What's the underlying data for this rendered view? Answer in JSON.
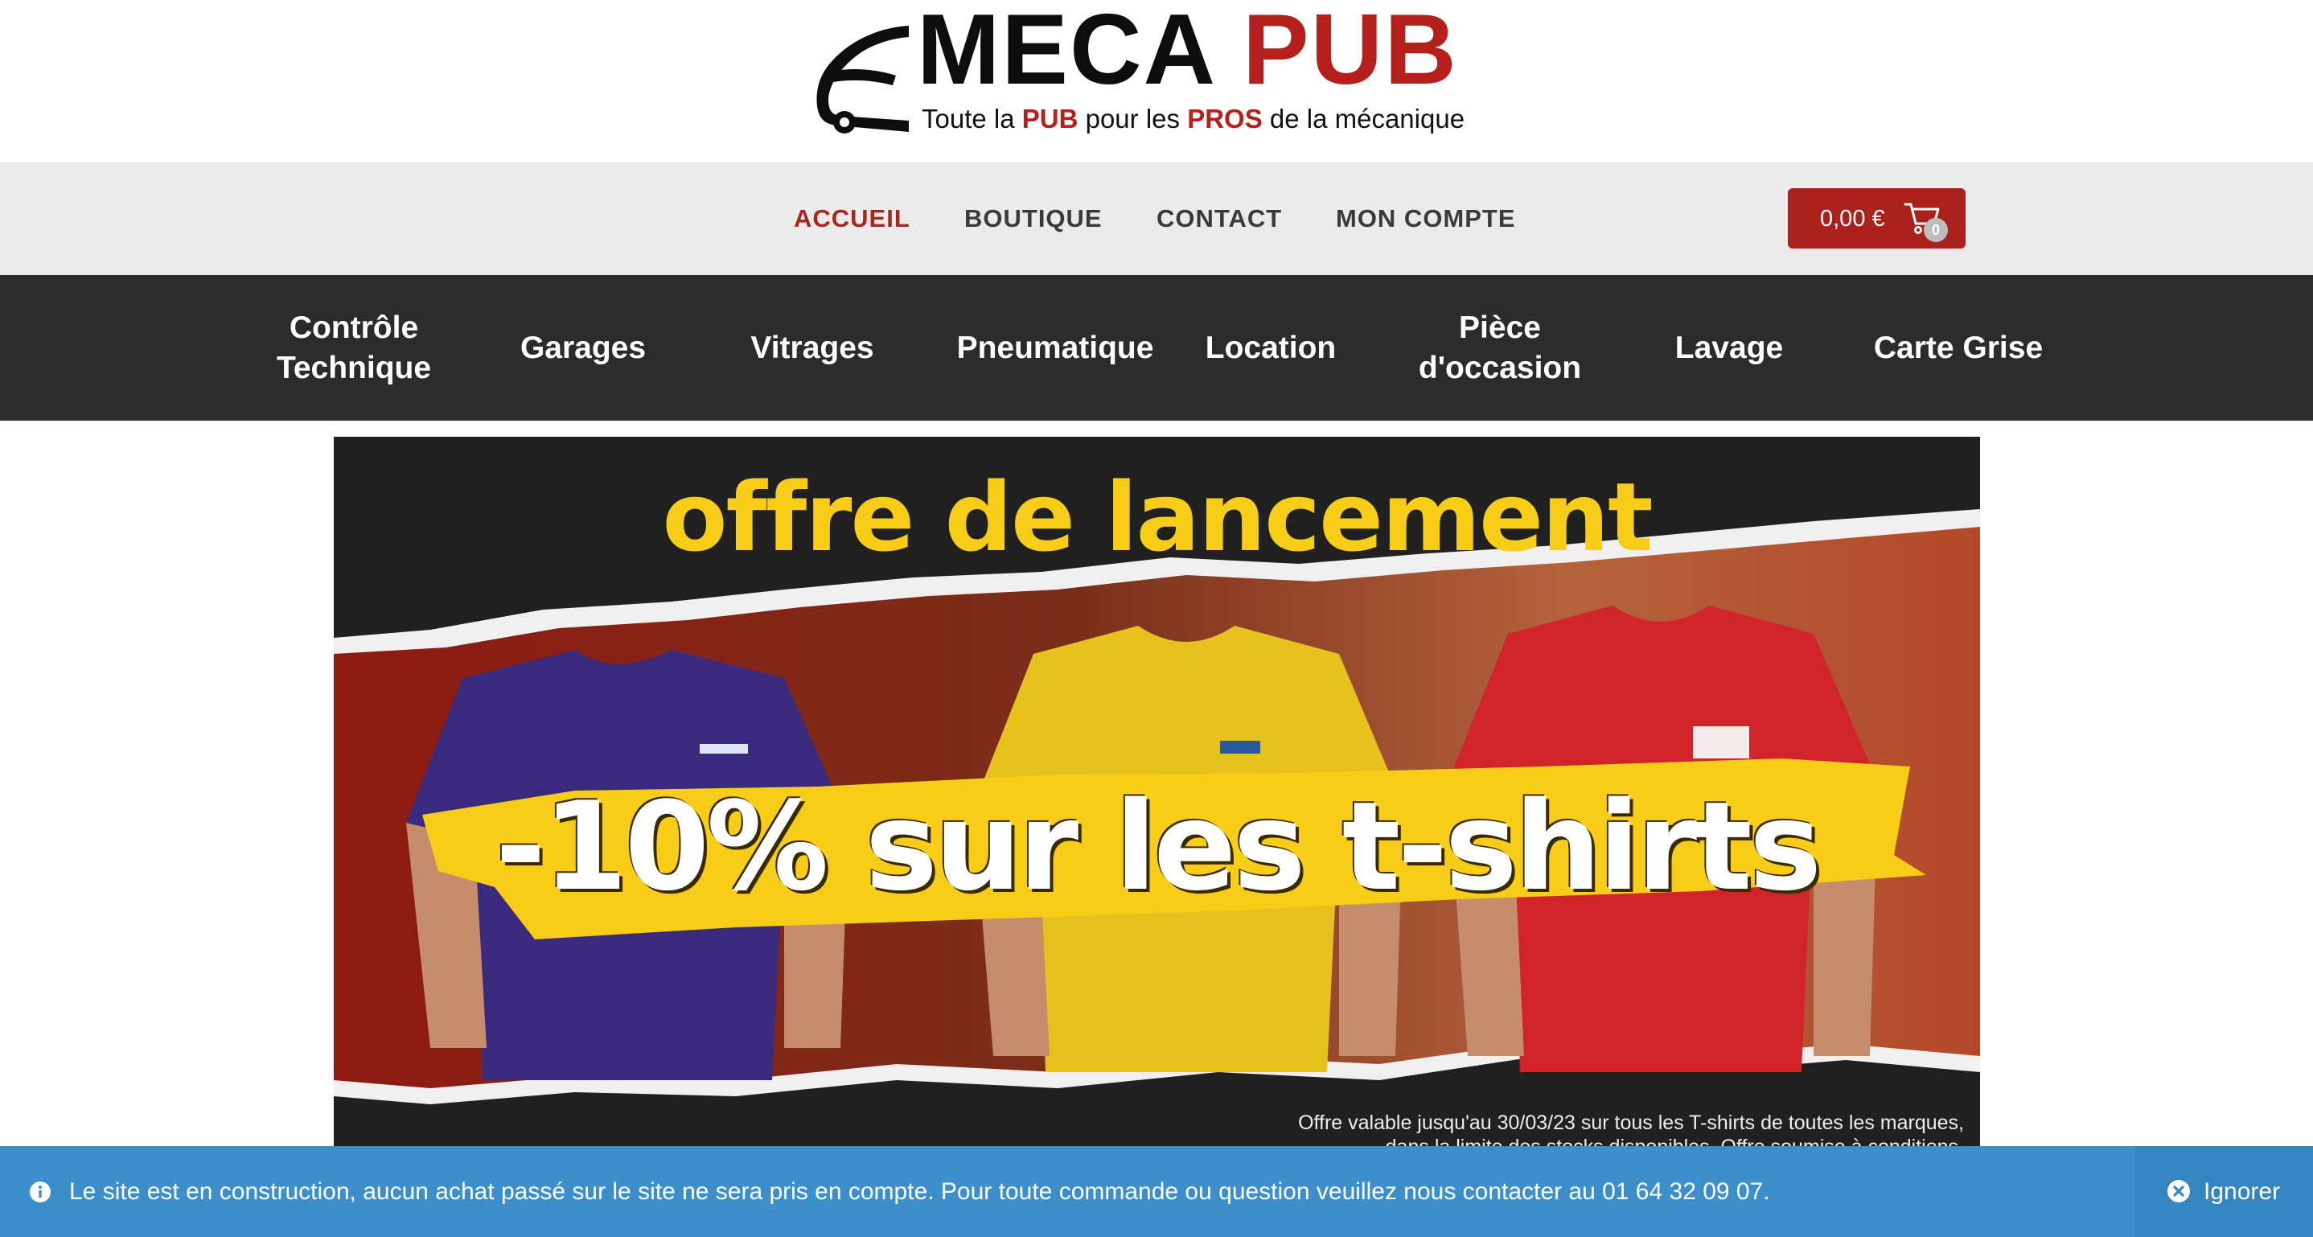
{
  "logo": {
    "word_1": "MECA",
    "word_2": "PUB",
    "tagline_1": "Toute la ",
    "tagline_2": "PUB",
    "tagline_3": " pour les ",
    "tagline_4": "PROS",
    "tagline_5": " de la mécanique"
  },
  "top_nav": {
    "items": [
      {
        "label": "ACCUEIL",
        "active": true
      },
      {
        "label": "BOUTIQUE",
        "active": false
      },
      {
        "label": "CONTACT",
        "active": false
      },
      {
        "label": "MON COMPTE",
        "active": false
      }
    ]
  },
  "cart": {
    "total": "0,00 €",
    "count": "0",
    "icon": "shopping-cart-icon"
  },
  "categories": [
    {
      "line1": "Contrôle",
      "line2": "Technique"
    },
    {
      "line1": "Garages",
      "line2": ""
    },
    {
      "line1": "Vitrages",
      "line2": ""
    },
    {
      "line1": "Pneumatique",
      "line2": ""
    },
    {
      "line1": "Location",
      "line2": ""
    },
    {
      "line1": "Pièce",
      "line2": "d'occasion"
    },
    {
      "line1": "Lavage",
      "line2": ""
    },
    {
      "line1": "Carte Grise",
      "line2": ""
    }
  ],
  "banner": {
    "headline": "offre de lancement",
    "promo": "-10% sur les t-shirts",
    "fine_print_1": "Offre valable jusqu'au 30/03/23 sur tous les T-shirts de toutes les marques,",
    "fine_print_2": "dans la limite des stocks disponibles. Offre soumise à conditions."
  },
  "notice": {
    "icon": "info-icon",
    "text": "Le site est en construction, aucun achat passé sur le site ne sera pris en compte. Pour toute commande ou question veuillez nous contacter au 01 64 32 09 07.",
    "dismiss_label": "Ignorer",
    "dismiss_icon": "close-circle-icon"
  },
  "colors": {
    "brand_red": "#b5201c",
    "nav_bg": "#ebebeb",
    "category_bg": "#2b2b2b",
    "banner_yellow": "#f7cd18",
    "notice_blue": "#3c8fcb"
  }
}
